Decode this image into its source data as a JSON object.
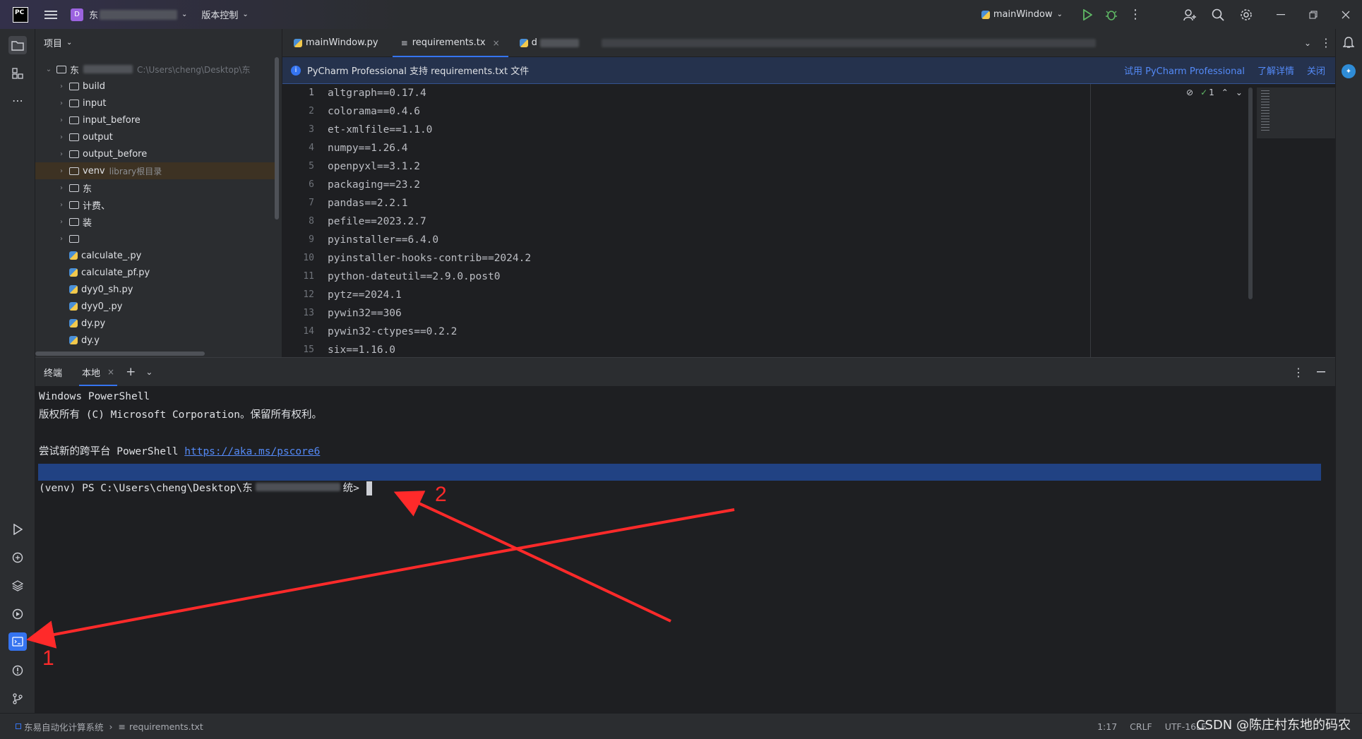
{
  "titlebar": {
    "project_badge": "D",
    "project_name_partial": "东",
    "vcs_label": "版本控制",
    "run_config": "mainWindow"
  },
  "project_panel": {
    "title": "项目",
    "root_name": "东",
    "root_path": "C:\\Users\\cheng\\Desktop\\东",
    "items": [
      {
        "type": "folder",
        "label": "build"
      },
      {
        "type": "folder",
        "label": "input"
      },
      {
        "type": "folder",
        "label": "input_before"
      },
      {
        "type": "folder",
        "label": "output"
      },
      {
        "type": "folder",
        "label": "output_before"
      },
      {
        "type": "folder",
        "label": "venv",
        "hint": "library根目录"
      },
      {
        "type": "folder",
        "label": "东"
      },
      {
        "type": "folder",
        "label": "计费、"
      },
      {
        "type": "folder",
        "label": "装"
      },
      {
        "type": "folder",
        "label": ""
      },
      {
        "type": "py",
        "label": "calculate_.py"
      },
      {
        "type": "py",
        "label": "calculate_pf.py"
      },
      {
        "type": "py",
        "label": "dyy0_sh.py"
      },
      {
        "type": "py",
        "label": "dyy0_.py"
      },
      {
        "type": "py",
        "label": "dy.py"
      },
      {
        "type": "py",
        "label": "dy.y"
      }
    ]
  },
  "editor": {
    "tabs": [
      {
        "label": "mainWindow.py",
        "active": false
      },
      {
        "label": "requirements.tx",
        "active": true
      },
      {
        "label": "d",
        "active": false
      }
    ],
    "banner": {
      "text": "PyCharm Professional 支持 requirements.txt 文件",
      "link1": "试用 PyCharm Professional",
      "link2": "了解详情",
      "link3": "关闭"
    },
    "inspection": "1",
    "lines": [
      "altgraph==0.17.4",
      "colorama==0.4.6",
      "et-xmlfile==1.1.0",
      "numpy==1.26.4",
      "openpyxl==3.1.2",
      "packaging==23.2",
      "pandas==2.2.1",
      "pefile==2023.2.7",
      "pyinstaller==6.4.0",
      "pyinstaller-hooks-contrib==2024.2",
      "python-dateutil==2.9.0.post0",
      "pytz==2024.1",
      "pywin32==306",
      "pywin32-ctypes==0.2.2",
      "six==1.16.0"
    ],
    "line_numbers": [
      "1",
      "2",
      "3",
      "4",
      "5",
      "6",
      "7",
      "8",
      "9",
      "10",
      "11",
      "12",
      "13",
      "14",
      "15"
    ]
  },
  "terminal": {
    "title": "终端",
    "tab": "本地",
    "lines": {
      "l1": "Windows PowerShell",
      "l2": "版权所有 (C) Microsoft Corporation。保留所有权利。",
      "l3_prefix": "尝试新的跨平台 PowerShell ",
      "l3_link": "https://aka.ms/pscore6",
      "prompt_prefix": "(venv) PS C:\\Users\\cheng\\Desktop\\东",
      "prompt_suffix": "统>"
    }
  },
  "annotations": {
    "label1": "1",
    "label2": "2"
  },
  "statusbar": {
    "project": "东易自动化计算系统",
    "file": "requirements.txt",
    "position": "1:17",
    "line_sep": "CRLF",
    "encoding": "UTF-16LE"
  },
  "watermark": "CSDN @陈庄村东地的码农",
  "colors": {
    "accent": "#3574f0",
    "arrow": "#ff2a2a",
    "selection": "#214283"
  }
}
